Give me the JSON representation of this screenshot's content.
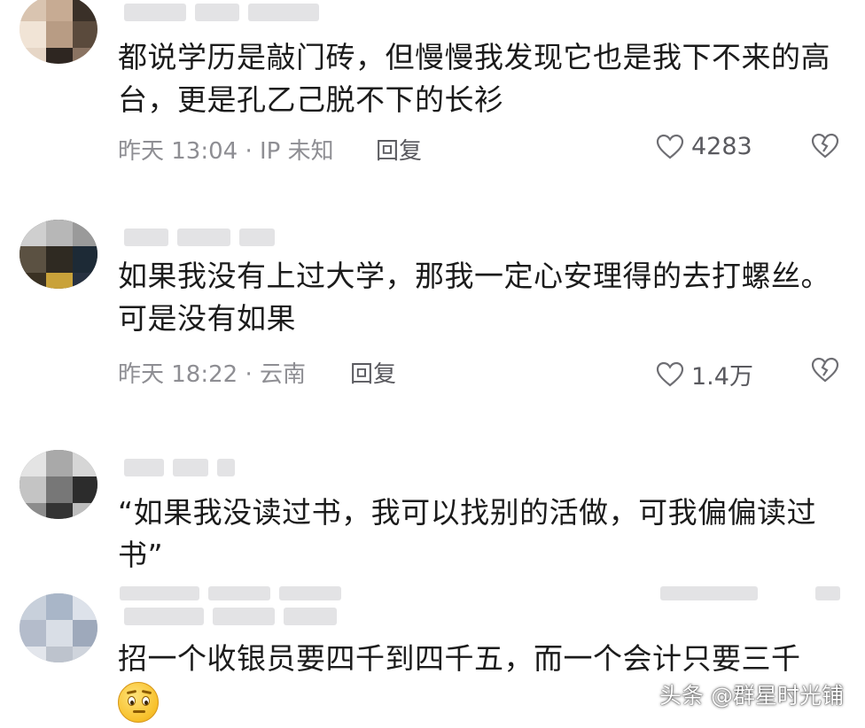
{
  "comments": [
    {
      "text": "都说学历是敲门砖，但慢慢我发现它也是我下不来的高台，更是孔乙己脱不下的长衫",
      "meta": "昨天 13:04 · IP 未知",
      "reply_label": "回复",
      "like_count": "4283"
    },
    {
      "text": "如果我没有上过大学，那我一定心安理得的去打螺丝。可是没有如果",
      "meta": "昨天 18:22 · 云南",
      "reply_label": "回复",
      "like_count": "1.4万"
    },
    {
      "text": "“如果我没读过书，我可以找别的活做，可我偏偏读过书”"
    },
    {
      "text": "招一个收银员要四千到四千五，而一个会计只要三千",
      "emoji": "confused-face-emoji"
    }
  ],
  "watermark": "头条 @群星时光铺",
  "colors": {
    "text": "#1b1b1b",
    "meta": "#8e8e93",
    "action": "#5a5a5f",
    "background": "#ffffff"
  },
  "icons": {
    "like": "heart-outline-icon",
    "dislike": "broken-heart-icon"
  }
}
